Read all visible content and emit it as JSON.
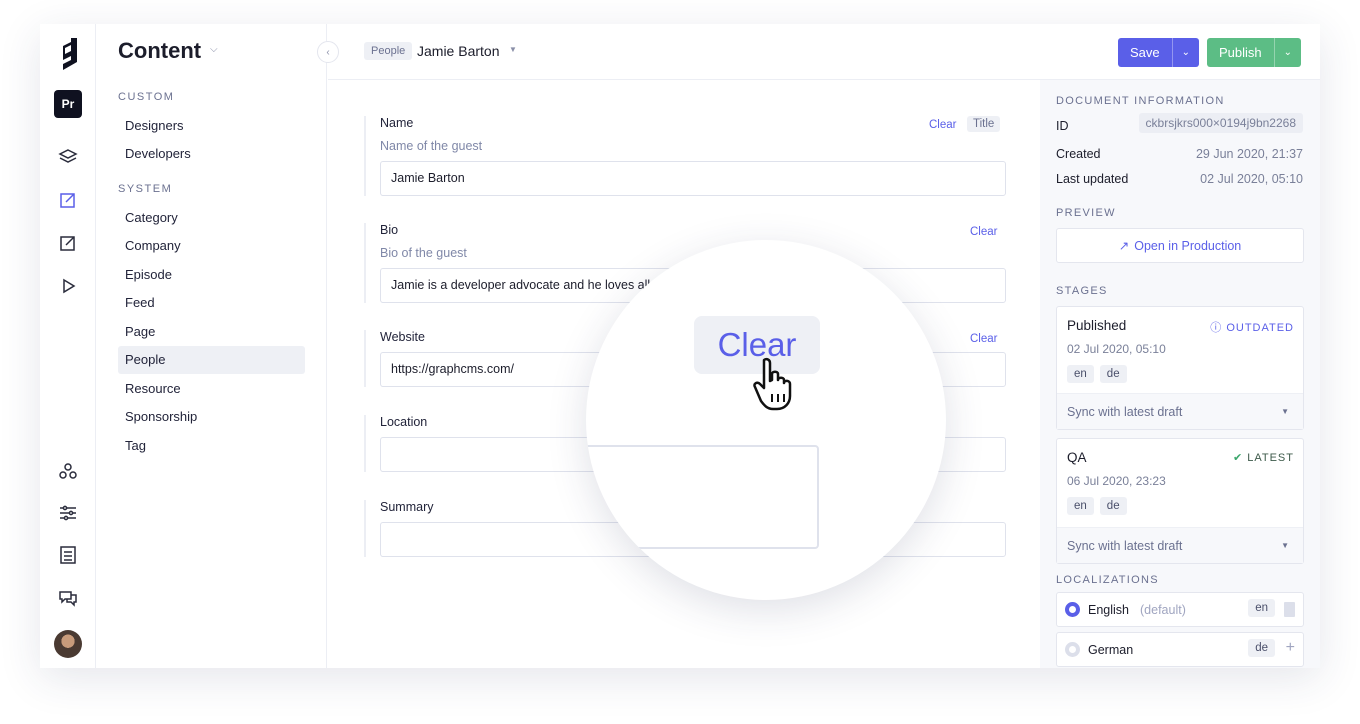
{
  "nav": {
    "title": "Content",
    "custom_label": "CUSTOM",
    "system_label": "SYSTEM",
    "custom_items": [
      "Designers",
      "Developers"
    ],
    "system_items": [
      "Category",
      "Company",
      "Episode",
      "Feed",
      "Page",
      "People",
      "Resource",
      "Sponsorship",
      "Tag"
    ],
    "active": "People"
  },
  "rail": {
    "project_badge": "Pr",
    "icons": [
      "logo-icon",
      "layers-icon",
      "edit-content-icon",
      "edit-icon",
      "play-icon",
      "webhooks-icon",
      "settings-sliders-icon",
      "docs-icon",
      "chat-icon"
    ]
  },
  "header": {
    "model_tag": "People",
    "entry_title": "Jamie Barton",
    "save_label": "Save",
    "publish_label": "Publish"
  },
  "form": {
    "clear_label": "Clear",
    "title_tag": "Title",
    "name": {
      "label": "Name",
      "hint": "Name of the guest",
      "value": "Jamie Barton"
    },
    "bio": {
      "label": "Bio",
      "hint": "Bio of the guest",
      "value": "Jamie is a developer advocate and he loves all t"
    },
    "website": {
      "label": "Website",
      "value": "https://graphcms.com/"
    },
    "location": {
      "label": "Location",
      "value": ""
    },
    "summary": {
      "label": "Summary",
      "value": ""
    }
  },
  "magnifier": {
    "label": "Clear"
  },
  "sidebar": {
    "doc_info_label": "DOCUMENT INFORMATION",
    "id_label": "ID",
    "id_value": "ckbrsjkrs000×0194j9bn2268",
    "created_label": "Created",
    "created_value": "29 Jun 2020, 21:37",
    "updated_label": "Last updated",
    "updated_value": "02 Jul 2020, 05:10",
    "preview_label": "PREVIEW",
    "open_prod": "Open in Production",
    "stages_label": "STAGES",
    "stages": [
      {
        "name": "Published",
        "status": "OUTDATED",
        "status_color": "#5a5fe8",
        "date": "02 Jul 2020, 05:10",
        "locales": [
          "en",
          "de"
        ],
        "sync": "Sync with latest draft"
      },
      {
        "name": "QA",
        "status": "LATEST",
        "status_color": "#3aa66b",
        "date": "06 Jul 2020, 23:23",
        "locales": [
          "en",
          "de"
        ],
        "sync": "Sync with latest draft"
      }
    ],
    "localizations_label": "LOCALIZATIONS",
    "locales": [
      {
        "name": "English",
        "suffix": "(default)",
        "code": "en"
      },
      {
        "name": "German",
        "code": "de"
      }
    ]
  },
  "colors": {
    "accent": "#5a5fe8",
    "publish": "#5cbd85"
  }
}
